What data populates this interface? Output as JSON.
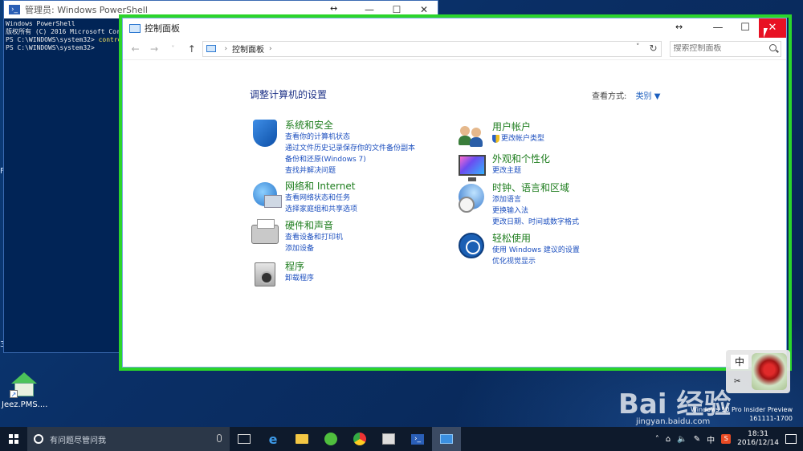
{
  "powershell": {
    "title": "管理员: Windows PowerShell",
    "lines": [
      "Windows PowerShell",
      "版权所有 (C) 2016 Microsoft Corpo",
      "",
      "PS C:\\WINDOWS\\system32> ",
      "PS C:\\WINDOWS\\system32>"
    ],
    "command": "control"
  },
  "desktop": {
    "icon_label": "Jeez.PMS....",
    "edge_marks": [
      "F",
      "3"
    ]
  },
  "control_panel": {
    "title": "控制面板",
    "address": {
      "root_icon": "control-panel-icon",
      "crumb": "控制面板"
    },
    "search_placeholder": "搜索控制面板",
    "heading": "调整计算机的设置",
    "view_by_label": "查看方式:",
    "view_by_value": "类别 ▼",
    "categories_left": [
      {
        "title": "系统和安全",
        "icon": "shield-icon",
        "links": [
          "查看你的计算机状态",
          "通过文件历史记录保存你的文件备份副本",
          "备份和还原(Windows 7)",
          "查找并解决问题"
        ]
      },
      {
        "title": "网络和 Internet",
        "icon": "network-icon",
        "links": [
          "查看网络状态和任务",
          "选择家庭组和共享选项"
        ]
      },
      {
        "title": "硬件和声音",
        "icon": "printer-icon",
        "links": [
          "查看设备和打印机",
          "添加设备"
        ]
      },
      {
        "title": "程序",
        "icon": "programs-icon",
        "links": [
          "卸载程序"
        ]
      }
    ],
    "categories_right": [
      {
        "title": "用户帐户",
        "icon": "users-icon",
        "links": [
          "更改帐户类型"
        ]
      },
      {
        "title": "外观和个性化",
        "icon": "display-icon",
        "links": [
          "更改主题"
        ]
      },
      {
        "title": "时钟、语言和区域",
        "icon": "clock-icon",
        "links": [
          "添加语言",
          "更换输入法",
          "更改日期、时间或数字格式"
        ]
      },
      {
        "title": "轻松使用",
        "icon": "accessibility-icon",
        "links": [
          "使用 Windows 建议的设置",
          "优化视觉显示"
        ]
      }
    ]
  },
  "ime": {
    "mode": "中"
  },
  "overlay": {
    "watermark": "Bai  经验",
    "watermark_url": "jingyan.baidu.com",
    "build_line1": "Windows 10 Pro Insider Preview",
    "build_line2": "161111-1700"
  },
  "taskbar": {
    "search_placeholder": "有问题尽管问我",
    "ime_tray": "中",
    "time": "18:31",
    "date": "2016/12/14"
  },
  "colors": {
    "highlight": "#2bd52b",
    "link": "#1c4fbf",
    "category_title": "#1e7d1e",
    "close_button": "#e81123"
  }
}
